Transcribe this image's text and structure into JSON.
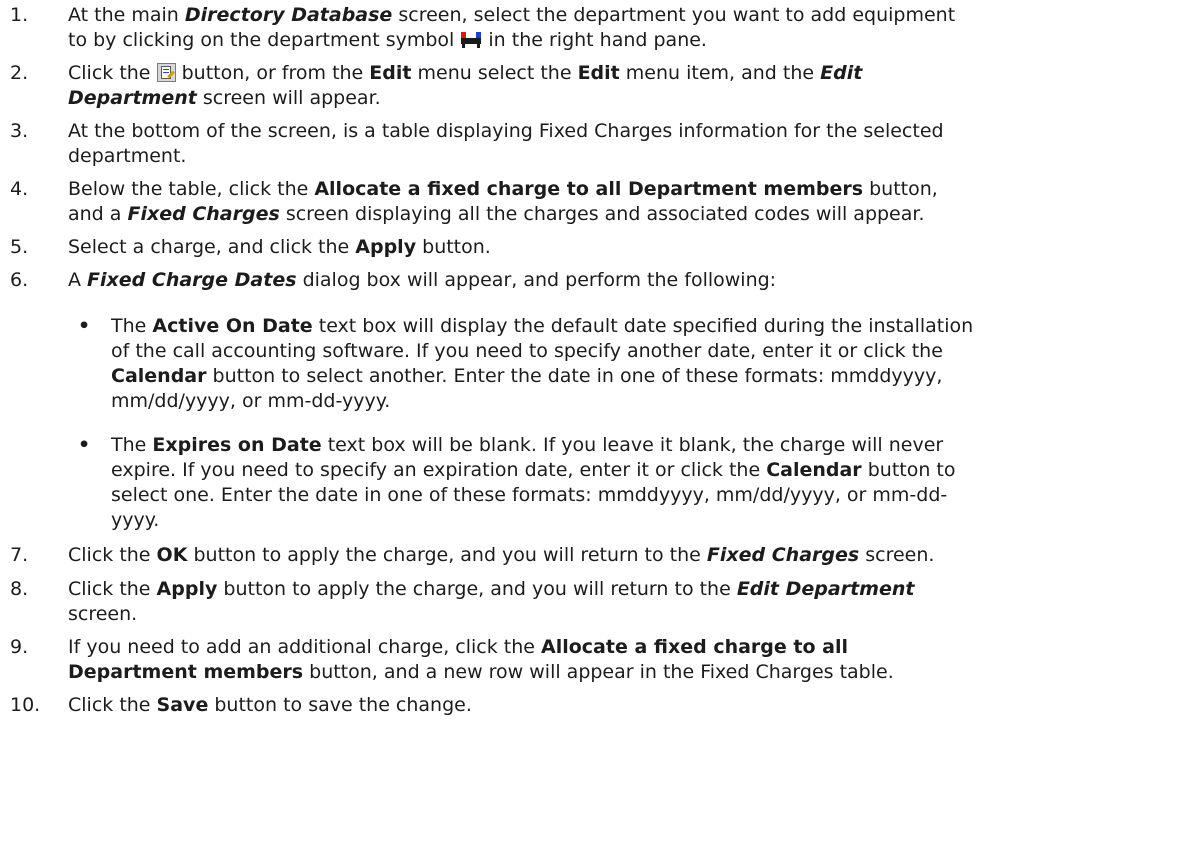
{
  "steps": [
    {
      "num": "1.",
      "line1": [
        "At the main ",
        "Directory Database",
        " screen, select the department you want to add equipment"
      ],
      "line2": [
        "to by clicking on the department symbol ",
        " in the right hand pane."
      ]
    },
    {
      "num": "2.",
      "line1": [
        "Click the ",
        " button, or from the ",
        "Edit",
        " menu select the ",
        "Edit",
        " menu item, and the ",
        "Edit"
      ],
      "line2": [
        "Department",
        " screen will appear."
      ]
    },
    {
      "num": "3.",
      "line1": [
        "At the bottom of the screen, is a table displaying Fixed Charges information for the selected"
      ],
      "line2": [
        "department."
      ]
    },
    {
      "num": "4.",
      "line1": [
        "Below the table, click the ",
        "Allocate a fixed charge to all Department members",
        " button,"
      ],
      "line2": [
        "and a ",
        "Fixed Charges",
        " screen displaying all the charges and associated codes will appear."
      ]
    },
    {
      "num": "5.",
      "line1": [
        "Select a charge, and click the ",
        "Apply",
        " button."
      ]
    },
    {
      "num": "6.",
      "line1": [
        "A ",
        "Fixed Charge Dates",
        " dialog box will appear, and perform the following:"
      ]
    },
    {
      "num": "7.",
      "line1": [
        "Click the ",
        "OK",
        " button to apply the charge, and you will return to the ",
        "Fixed Charges",
        " screen."
      ]
    },
    {
      "num": "8.",
      "line1": [
        "Click the ",
        "Apply",
        " button to apply the charge, and you will return to the ",
        "Edit Department"
      ],
      "line2": [
        "screen."
      ]
    },
    {
      "num": "9.",
      "line1": [
        "If you need to add an additional charge, click the ",
        "Allocate a fixed charge to all"
      ],
      "line2": [
        "Department members",
        " button, and a new row will appear in the Fixed Charges table."
      ]
    },
    {
      "num": "10.",
      "line1": [
        "Click the ",
        "Save",
        " button to save the change."
      ]
    }
  ],
  "bullets": [
    {
      "symbol": "•",
      "lines": [
        [
          "The ",
          "Active On Date",
          " text box will display the default date specified during the installation"
        ],
        [
          "of the call accounting software. If you need to specify another date, enter it or click the"
        ],
        [
          "Calendar",
          " button to select another. Enter the date in one of these formats:  mmddyyyy,"
        ],
        [
          "mm/dd/yyyy, or mm-dd-yyyy."
        ]
      ]
    },
    {
      "symbol": "•",
      "lines": [
        [
          "The ",
          "Expires on Date",
          " text box will be blank. If you leave it blank, the charge will never"
        ],
        [
          "expire. If you need to specify an expiration date, enter it or click the ",
          "Calendar",
          " button to"
        ],
        [
          "select one. Enter the date in one of these formats:  mmddyyyy, mm/dd/yyyy, or mm-dd-"
        ],
        [
          "yyyy."
        ]
      ]
    }
  ],
  "icons": {
    "department_icon": "department-icon",
    "edit_button_icon": "edit-button-icon"
  }
}
